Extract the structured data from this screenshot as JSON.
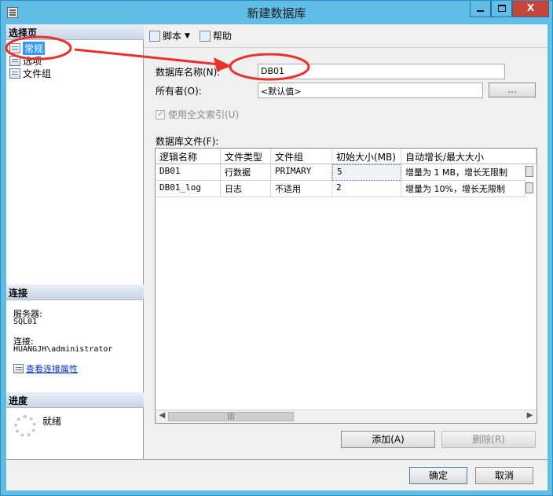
{
  "window": {
    "title": "新建数据库",
    "minimize_label": "",
    "maximize_label": "",
    "close_label": "X"
  },
  "left": {
    "select_page_header": "选择页",
    "pages": [
      {
        "label": "常规",
        "selected": true
      },
      {
        "label": "选项",
        "selected": false
      },
      {
        "label": "文件组",
        "selected": false
      }
    ],
    "connection_header": "连接",
    "server_label": "服务器:",
    "server_value": "SQL01",
    "connection_label": "连接:",
    "connection_value": "HUANGJH\\administrator",
    "view_conn_props": "查看连接属性",
    "progress_header": "进度",
    "progress_status": "就绪"
  },
  "toolbar": {
    "script_label": "脚本",
    "help_label": "帮助"
  },
  "form": {
    "db_name_label": "数据库名称(N):",
    "db_name_value": "DB01",
    "owner_label": "所有者(O):",
    "owner_value": "<默认值>",
    "browse_label": "...",
    "fulltext_label": "使用全文索引(U)",
    "fulltext_checked": true,
    "files_label": "数据库文件(F):"
  },
  "grid": {
    "columns": [
      "逻辑名称",
      "文件类型",
      "文件组",
      "初始大小(MB)",
      "自动增长/最大大小"
    ],
    "rows": [
      [
        "DB01",
        "行数据",
        "PRIMARY",
        "5",
        "增量为 1 MB，增长无限制"
      ],
      [
        "DB01_log",
        "日志",
        "不适用",
        "2",
        "增量为 10%，增长无限制"
      ]
    ]
  },
  "buttons": {
    "add": "添加(A)",
    "remove": "删除(R)",
    "ok": "确定",
    "cancel": "取消"
  },
  "colors": {
    "title_bar": "#5fbde6",
    "close_button": "#c7463c",
    "selection": "#3399ff",
    "annotation": "#e8322d"
  }
}
